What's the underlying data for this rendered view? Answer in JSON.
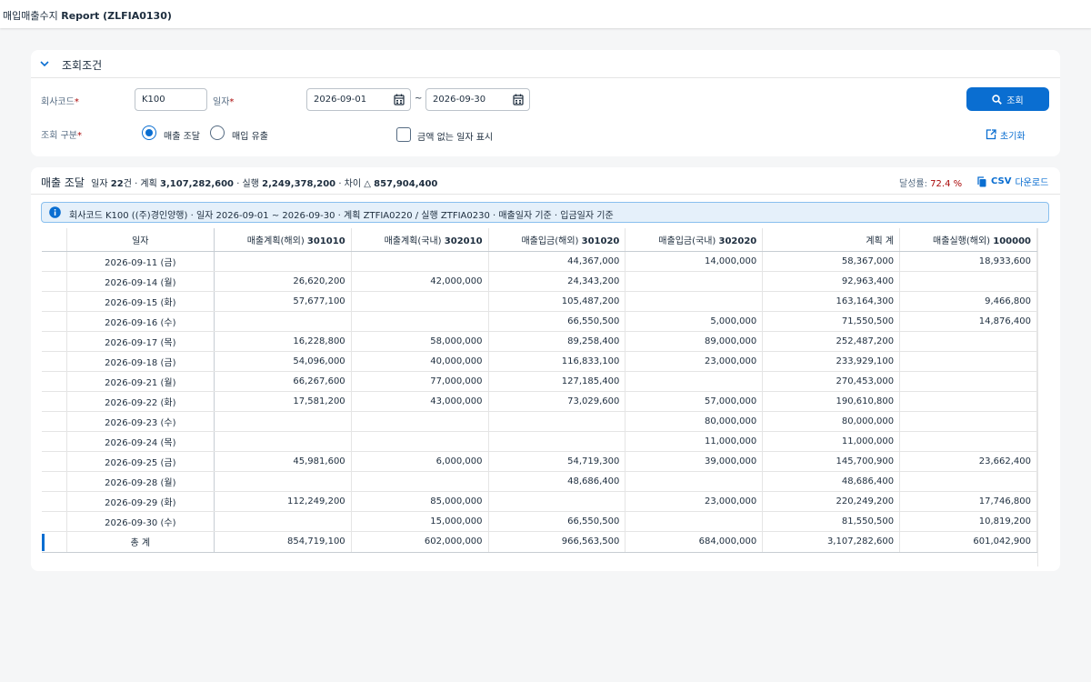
{
  "app": {
    "title_prefix": "매입매출수지",
    "title_suffix": "Report (ZLFIA0130)"
  },
  "filter": {
    "section_title": "조회조건",
    "company_label": "회사코드",
    "company_value": "K100",
    "date_label": "일자",
    "date_from": "2026-09-01",
    "tilde": "~",
    "date_to": "2026-09-30",
    "type_label": "조회 구분",
    "required_mark": "*",
    "radio_sales": "매출 조달",
    "radio_purchase": "매입 유출",
    "show_empty_label": "금액 없는 일자 표시",
    "search_label": "조회",
    "reset_label": "초기화"
  },
  "result": {
    "mode": "매출 조달",
    "days_label": "일자",
    "days_value": "22",
    "days_unit": "건 · 계획",
    "plan_value": "3,107,282,600",
    "exec_label": "· 실행",
    "exec_value": "2,249,378,200",
    "diff_label": "· 차이 △",
    "diff_value": "857,904,400",
    "rate_label": "달성률:",
    "rate_value": "72.4 %",
    "csv_bold": "CSV",
    "csv_rest": "다운로드",
    "info_text": "회사코드 K100 ((주)경인양행) · 일자 2026-09-01 ~ 2026-09-30 · 계획 ZTFIA0220 / 실행 ZTFIA0230 · 매출일자 기준 · 입금일자 기준"
  },
  "table": {
    "headers": [
      {
        "text": "일자",
        "code": ""
      },
      {
        "text": "매출계획(해외)",
        "code": "301010"
      },
      {
        "text": "매출계획(국내)",
        "code": "302010"
      },
      {
        "text": "매출입금(해외)",
        "code": "301020"
      },
      {
        "text": "매출입금(국내)",
        "code": "302020"
      },
      {
        "text": "계획 계",
        "code": ""
      },
      {
        "text": "매출실행(해외)",
        "code": "100000"
      }
    ],
    "rows": [
      [
        "2026-09-11 (금)",
        "",
        "",
        "44,367,000",
        "14,000,000",
        "58,367,000",
        "18,933,600"
      ],
      [
        "2026-09-14 (월)",
        "26,620,200",
        "42,000,000",
        "24,343,200",
        "",
        "92,963,400",
        ""
      ],
      [
        "2026-09-15 (화)",
        "57,677,100",
        "",
        "105,487,200",
        "",
        "163,164,300",
        "9,466,800"
      ],
      [
        "2026-09-16 (수)",
        "",
        "",
        "66,550,500",
        "5,000,000",
        "71,550,500",
        "14,876,400"
      ],
      [
        "2026-09-17 (목)",
        "16,228,800",
        "58,000,000",
        "89,258,400",
        "89,000,000",
        "252,487,200",
        ""
      ],
      [
        "2026-09-18 (금)",
        "54,096,000",
        "40,000,000",
        "116,833,100",
        "23,000,000",
        "233,929,100",
        ""
      ],
      [
        "2026-09-21 (월)",
        "66,267,600",
        "77,000,000",
        "127,185,400",
        "",
        "270,453,000",
        ""
      ],
      [
        "2026-09-22 (화)",
        "17,581,200",
        "43,000,000",
        "73,029,600",
        "57,000,000",
        "190,610,800",
        ""
      ],
      [
        "2026-09-23 (수)",
        "",
        "",
        "",
        "80,000,000",
        "80,000,000",
        ""
      ],
      [
        "2026-09-24 (목)",
        "",
        "",
        "",
        "11,000,000",
        "11,000,000",
        ""
      ],
      [
        "2026-09-25 (금)",
        "45,981,600",
        "6,000,000",
        "54,719,300",
        "39,000,000",
        "145,700,900",
        "23,662,400"
      ],
      [
        "2026-09-28 (월)",
        "",
        "",
        "48,686,400",
        "",
        "48,686,400",
        ""
      ],
      [
        "2026-09-29 (화)",
        "112,249,200",
        "85,000,000",
        "",
        "23,000,000",
        "220,249,200",
        "17,746,800"
      ],
      [
        "2026-09-30 (수)",
        "",
        "15,000,000",
        "66,550,500",
        "",
        "81,550,500",
        "10,819,200"
      ]
    ],
    "total": [
      "총 계",
      "854,719,100",
      "602,000,000",
      "966,563,500",
      "684,000,000",
      "3,107,282,600",
      "601,042,900"
    ]
  },
  "colors": {
    "accent": "#0a6ed1",
    "required": "#aa0808",
    "info_bg": "#e5f0fa"
  }
}
